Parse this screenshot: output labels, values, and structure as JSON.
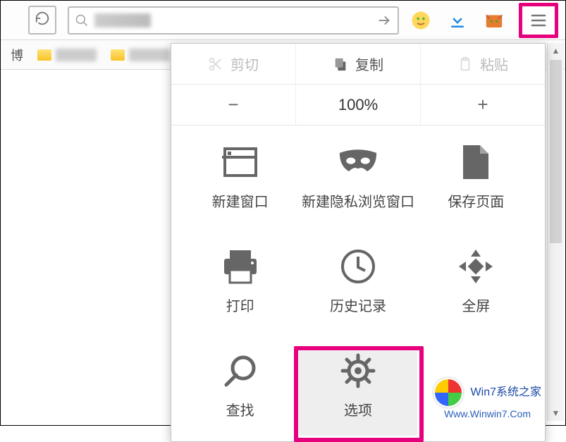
{
  "toolbar": {
    "reload_title": "Reload",
    "search_placeholder": "Search",
    "go_title": "Go",
    "menu_title": "Open menu"
  },
  "clipboard": {
    "cut": "剪切",
    "copy": "复制",
    "paste": "粘贴"
  },
  "zoom": {
    "out": "−",
    "level": "100%",
    "in": "+"
  },
  "grid": {
    "new_window": "新建窗口",
    "private_window": "新建隐私浏览窗口",
    "save_page": "保存页面",
    "print": "打印",
    "history": "历史记录",
    "fullscreen": "全屏",
    "find": "查找",
    "options": "选项"
  },
  "watermark": {
    "line1": "Win7系统之家",
    "line2": "Www.Winwin7.Com"
  }
}
